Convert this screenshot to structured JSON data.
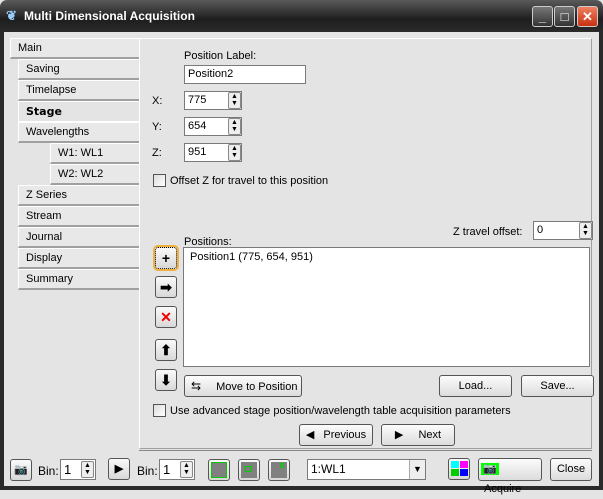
{
  "window": {
    "title": "Multi Dimensional Acquisition",
    "minimize": "_",
    "maximize": "□",
    "close": "✕"
  },
  "tabs": [
    {
      "label": "Main"
    },
    {
      "label": "Saving"
    },
    {
      "label": "Timelapse"
    },
    {
      "label": "Stage",
      "selected": true
    },
    {
      "label": "Wavelengths"
    },
    {
      "label": "W1: WL1"
    },
    {
      "label": "W2: WL2"
    },
    {
      "label": "Z Series"
    },
    {
      "label": "Stream"
    },
    {
      "label": "Journal"
    },
    {
      "label": "Display"
    },
    {
      "label": "Summary"
    }
  ],
  "stage": {
    "position_label": "Position Label:",
    "position_value": "Position2",
    "x_label": "X:",
    "x_value": "775",
    "y_label": "Y:",
    "y_value": "654",
    "z_label": "Z:",
    "z_value": "951",
    "offset_z_label": "Offset Z for travel to this position",
    "offset_z_checked": false,
    "z_travel_label": "Z travel offset:",
    "z_travel_value": "0",
    "positions_label": "Positions:",
    "positions": [
      "Position1 (775, 654, 951)"
    ],
    "move_button": "Move to Position",
    "load_button": "Load...",
    "save_button": "Save...",
    "advanced_label": "Use advanced stage position/wavelength table acquisition parameters",
    "advanced_checked": false,
    "previous_button": "Previous",
    "next_button": "Next"
  },
  "toolbar": {
    "bin_label": "Bin:",
    "bin1_value": "1",
    "bin2_value": "1",
    "wavelength_select": "1:WL1",
    "acquire_button": "Acquire",
    "close_button": "Close"
  }
}
